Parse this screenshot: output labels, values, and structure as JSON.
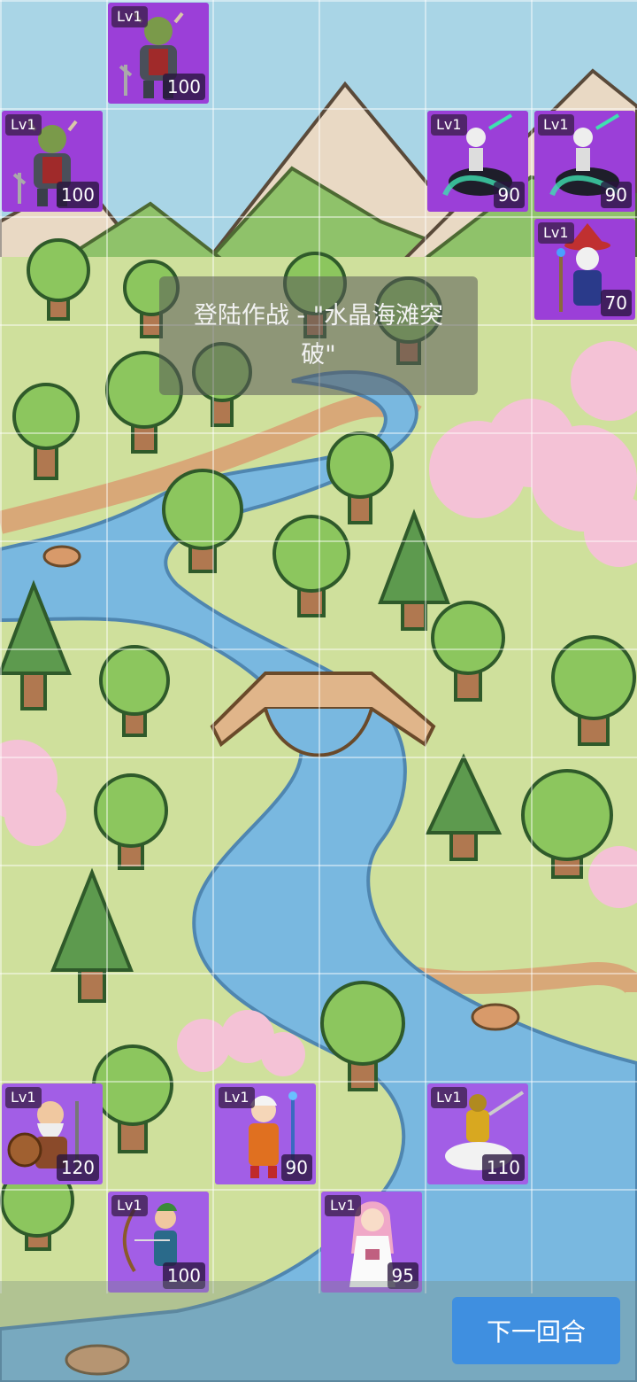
{
  "banner": {
    "text": "登陆作战 - \"水晶海滩突破\""
  },
  "next_button": {
    "label": "下一回合"
  },
  "units": [
    {
      "id": "enemy-orc-1",
      "side": "enemy",
      "type": "orc-warrior",
      "level": "Lv1",
      "hp": "100"
    },
    {
      "id": "enemy-orc-2",
      "side": "enemy",
      "type": "orc-warrior",
      "level": "Lv1",
      "hp": "100"
    },
    {
      "id": "enemy-skeleton-rider-1",
      "side": "enemy",
      "type": "skeleton-rider",
      "level": "Lv1",
      "hp": "90"
    },
    {
      "id": "enemy-skeleton-rider-2",
      "side": "enemy",
      "type": "skeleton-rider",
      "level": "Lv1",
      "hp": "90"
    },
    {
      "id": "enemy-skeleton-mage",
      "side": "enemy",
      "type": "skeleton-mage",
      "level": "Lv1",
      "hp": "70"
    },
    {
      "id": "ally-dwarf",
      "side": "ally",
      "type": "dwarf-warrior",
      "level": "Lv1",
      "hp": "120"
    },
    {
      "id": "ally-mage",
      "side": "ally",
      "type": "young-mage",
      "level": "Lv1",
      "hp": "90"
    },
    {
      "id": "ally-knight",
      "side": "ally",
      "type": "mounted-knight",
      "level": "Lv1",
      "hp": "110"
    },
    {
      "id": "ally-archer",
      "side": "ally",
      "type": "elf-archer",
      "level": "Lv1",
      "hp": "100"
    },
    {
      "id": "ally-priestess",
      "side": "ally",
      "type": "priestess",
      "level": "Lv1",
      "hp": "95"
    }
  ]
}
